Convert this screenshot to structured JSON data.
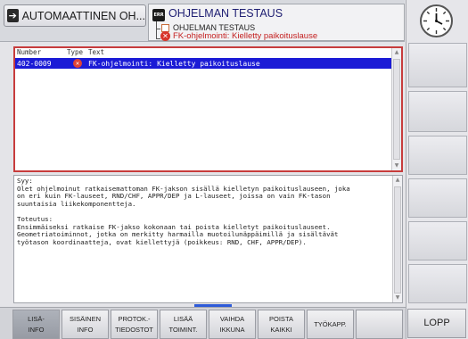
{
  "header": {
    "mode_tab_label": "AUTOMAATTINEN OH...",
    "test_icon_text": "ERR",
    "test_title": "OHJELMAN TESTAUS",
    "sub_title": "OHJELMAN TESTAUS",
    "error_line": "FK-ohjelmointi: Kielletty paikoituslause"
  },
  "list": {
    "columns": [
      "Number",
      "Type",
      "Text"
    ],
    "rows": [
      {
        "number": "402-0009",
        "type_icon": "error-icon",
        "text": "FK-ohjelmointi: Kielletty paikoituslause"
      }
    ]
  },
  "detail": {
    "text": "Syy:\nOlet ohjelmoinut ratkaisemattoman FK-jakson sisällä kielletyn paikoituslauseen, joka\non eri kuin FK-lauseet, RND/CHF, APPR/DEP ja L-lauseet, joissa on vain FK-tason\nsuuntaisia liikekomponentteja.\n\nToteutus:\nEnsimmäiseksi ratkaise FK-jakso kokonaan tai poista kielletyt paikoituslauseet.\nGeometriatoiminnot, jotka on merkitty harmailla muotoilunäppäimillä ja sisältävät\ntyötason koordinaatteja, ovat kiellettyjä (poikkeus: RND, CHF, APPR/DEP)."
  },
  "softkeys": [
    {
      "line1": "LISÄ-",
      "line2": "INFO",
      "active": true
    },
    {
      "line1": "SISÄINEN",
      "line2": "INFO",
      "active": false
    },
    {
      "line1": "PROTOK.-",
      "line2": "TIEDOSTOT",
      "active": false
    },
    {
      "line1": "LISÄÄ",
      "line2": "TOIMINT.",
      "active": false
    },
    {
      "line1": "VAIHDA",
      "line2": "IKKUNA",
      "active": false
    },
    {
      "line1": "POISTA",
      "line2": "KAIKKI",
      "active": false
    },
    {
      "line1": "TYÖKAPP.",
      "line2": "",
      "active": false
    }
  ],
  "end_button_label": "LOPP",
  "icons": {
    "mode_tab": "program-run-icon",
    "clock": "clock-icon",
    "home": "home-icon",
    "error": "error-icon"
  },
  "colors": {
    "selection": "#1b1bd6",
    "error": "#d8352a",
    "active_panel_border": "#c73c3c",
    "header_title": "#202073"
  }
}
